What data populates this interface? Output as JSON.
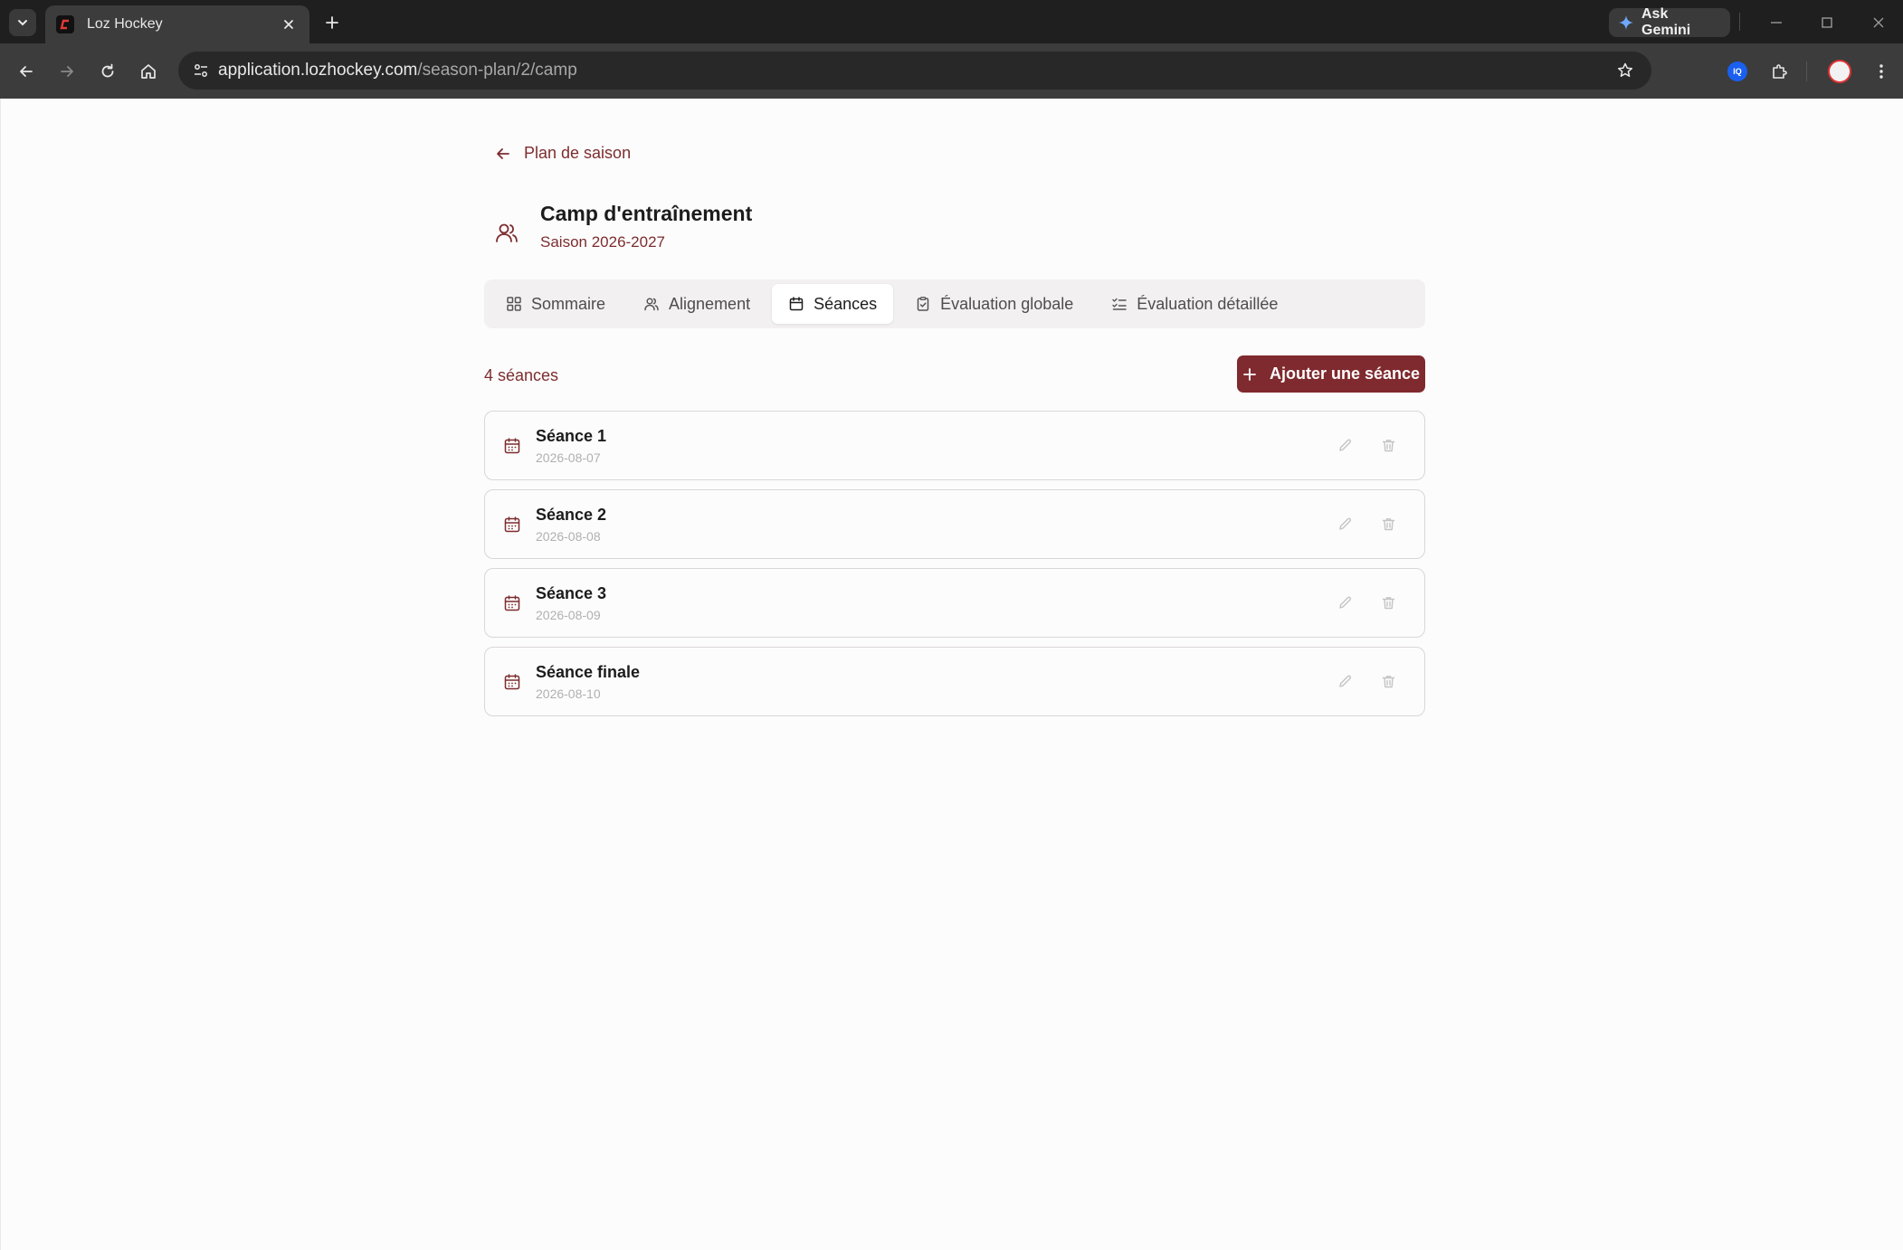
{
  "browser": {
    "tab_title": "Loz Hockey",
    "gemini_label": "Ask Gemini",
    "url_host": "application.lozhockey.com",
    "url_path": "/season-plan/2/camp",
    "extension_badge": "IQ"
  },
  "page": {
    "back_label": "Plan de saison",
    "title": "Camp d'entraînement",
    "subtitle": "Saison 2026-2027",
    "tabs": [
      {
        "label": "Sommaire",
        "icon": "grid-icon"
      },
      {
        "label": "Alignement",
        "icon": "users-icon"
      },
      {
        "label": "Séances",
        "icon": "calendar-icon",
        "active": true
      },
      {
        "label": "Évaluation globale",
        "icon": "clipboard-check-icon"
      },
      {
        "label": "Évaluation détaillée",
        "icon": "list-check-icon"
      }
    ],
    "count_label": "4 séances",
    "add_button_label": "Ajouter une séance",
    "sessions": [
      {
        "name": "Séance 1",
        "date": "2026-08-07"
      },
      {
        "name": "Séance 2",
        "date": "2026-08-08"
      },
      {
        "name": "Séance 3",
        "date": "2026-08-09"
      },
      {
        "name": "Séance finale",
        "date": "2026-08-10"
      }
    ]
  },
  "colors": {
    "accent": "#7f2a2e",
    "accent_text": "#7c2d2f",
    "muted_text": "#b0b0b0"
  }
}
